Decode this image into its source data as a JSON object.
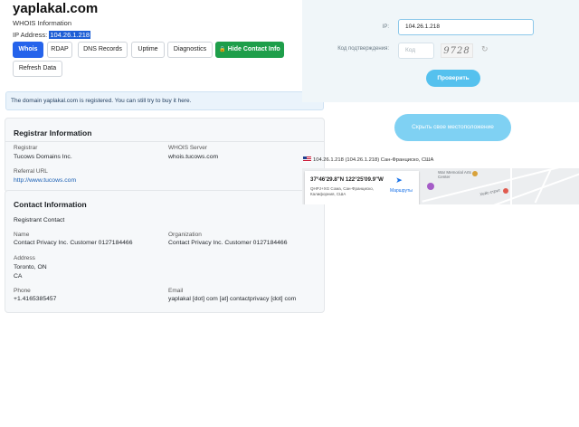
{
  "header": {
    "title": "yaplakal.com",
    "subtitle": "WHOIS Information",
    "ip_label": "IP Address:",
    "ip_value": "104.26.1.218"
  },
  "tabs": [
    {
      "label": "Whois"
    },
    {
      "label": "RDAP"
    },
    {
      "label": "DNS Records"
    },
    {
      "label": "Uptime"
    },
    {
      "label": "Diagnostics"
    },
    {
      "label": "Hide Contact Info"
    },
    {
      "label": "Refresh Data"
    }
  ],
  "notice": {
    "text": "The domain yaplakal.com is registered. You can still try to buy it here."
  },
  "registrar": {
    "title": "Registrar Information",
    "registrar_label": "Registrar",
    "registrar_value": "Tucows Domains Inc.",
    "whois_label": "WHOIS Server",
    "whois_value": "whois.tucows.com",
    "referral_label": "Referral URL",
    "referral_value": "http://www.tucows.com"
  },
  "contact": {
    "title": "Contact Information",
    "section": "Registrant Contact",
    "name_label": "Name",
    "name_value": "Contact Privacy Inc. Customer 0127184466",
    "org_label": "Organization",
    "org_value": "Contact Privacy Inc. Customer 0127184466",
    "address_label": "Address",
    "address_line1": "Toronto, ON",
    "address_line2": "CA",
    "phone_label": "Phone",
    "phone_value": "+1.4165385457",
    "email_label": "Email",
    "email_value": "yaplakal [dot] com [at] contactprivacy [dot] com"
  },
  "geo": {
    "ip_label": "IP:",
    "ip_value": "104.26.1.218",
    "captcha_label": "Код подтверждения:",
    "captcha_placeholder": "Код",
    "captcha_text": "9728",
    "check_button": "Проверить",
    "hide_button": "Скрыть свое местоположение",
    "location_text": "104.26.1.218 (104.26.1.218) Сан-Франциско, США"
  },
  "map": {
    "coords": "37°46'29.8\"N 122°25'09.9\"W",
    "address": "QHPJ+XG Сома, Сан-Франциско, Калифорния, США",
    "route_label": "Маршруты",
    "street_label": "Хейс-стрит",
    "poi_label": "War Memorial Arts Center"
  },
  "colors": {
    "primary": "#2563eb",
    "success": "#1e9e4a",
    "geo_button": "#55c1ee",
    "geo_bg": "#f0f6f9"
  }
}
